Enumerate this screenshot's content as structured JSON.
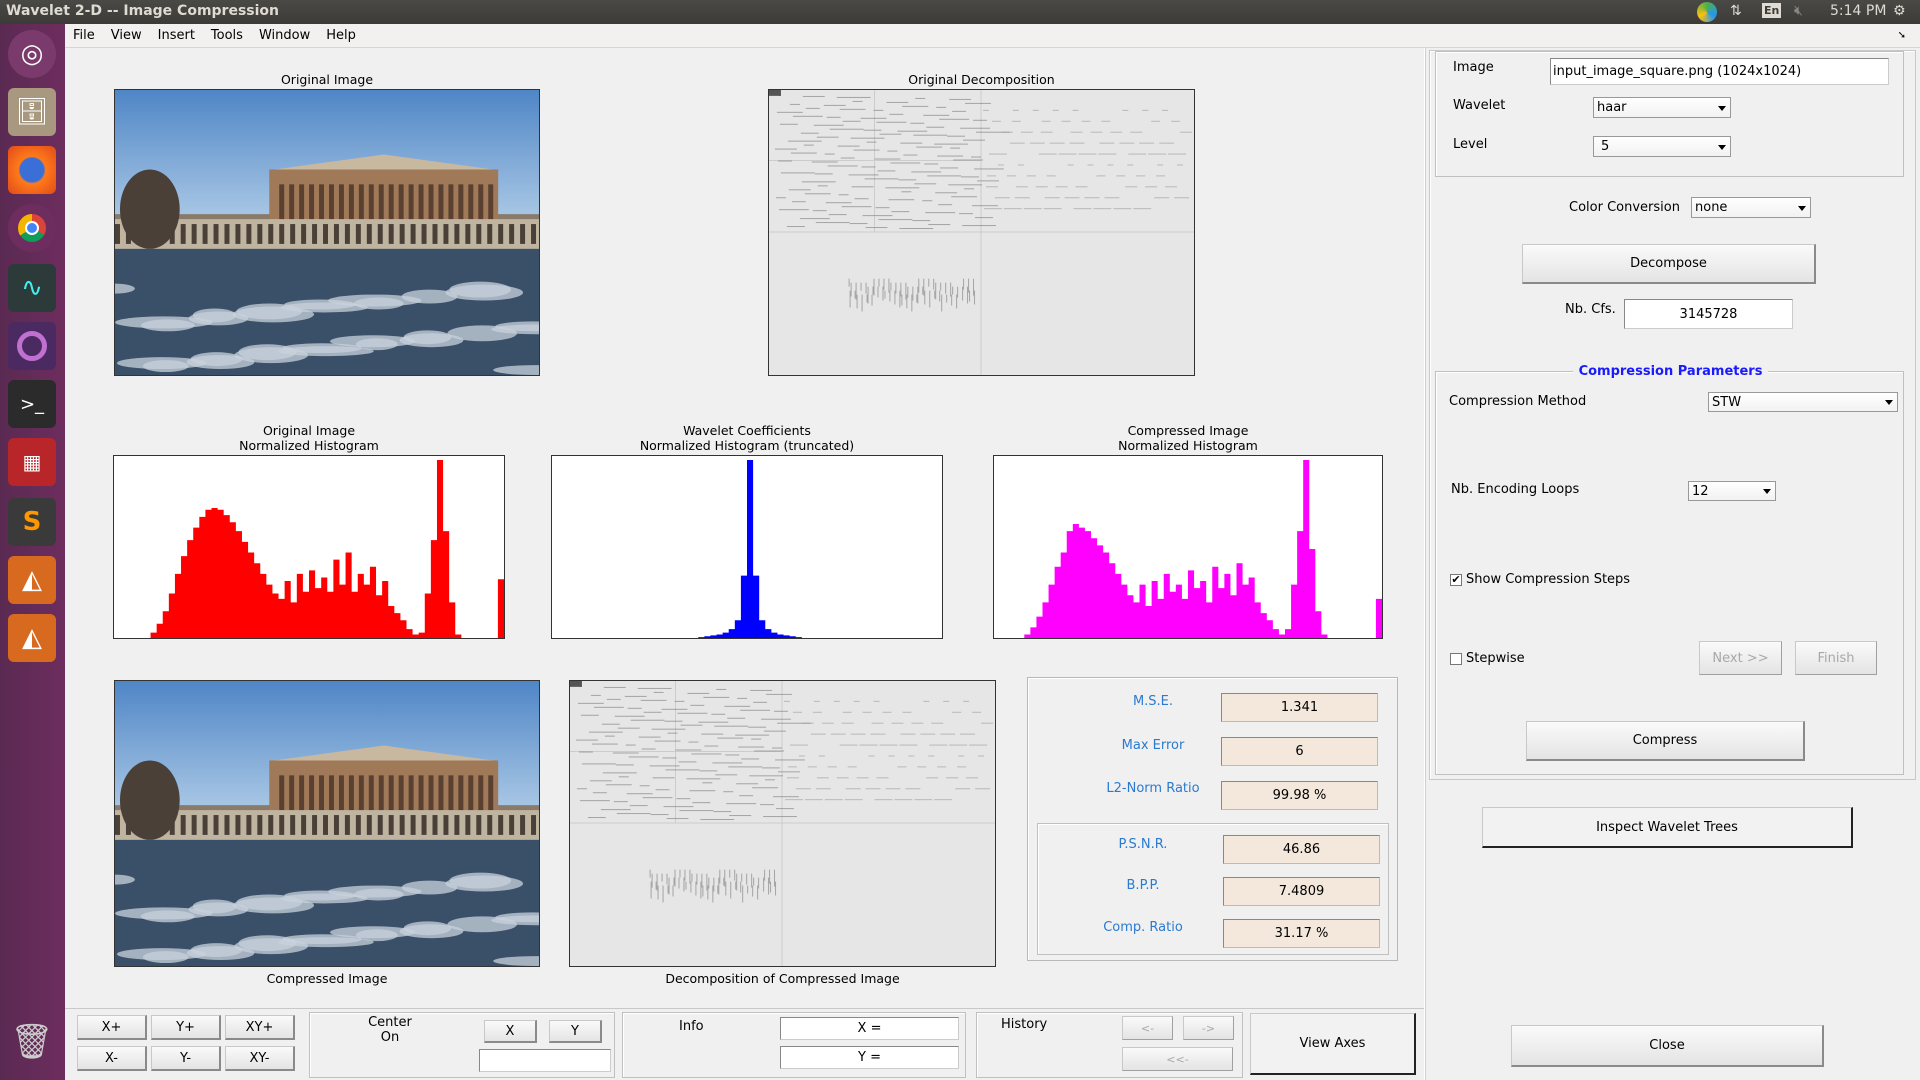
{
  "window": {
    "title": "Wavelet 2-D -- Image Compression",
    "time": "5:14 PM",
    "keyboard": "En"
  },
  "menu": [
    "File",
    "View",
    "Insert",
    "Tools",
    "Window",
    "Help"
  ],
  "launcher": [
    "ubuntu-dash-icon",
    "files-icon",
    "firefox-icon",
    "chrome-icon",
    "system-monitor-icon",
    "app-icon",
    "terminal-icon",
    "presentation-icon",
    "sublime-text-icon",
    "matlab-icon",
    "matlab-icon",
    "trash-icon"
  ],
  "axes": {
    "original_image": "Original Image",
    "original_decomposition": "Original Decomposition",
    "hist_original": [
      "Original Image",
      "Normalized Histogram"
    ],
    "hist_coeffs": [
      "Wavelet Coefficients",
      "Normalized Histogram (truncated)"
    ],
    "hist_compressed": [
      "Compressed Image",
      "Normalized Histogram"
    ],
    "compressed_image": "Compressed Image",
    "compressed_decomposition": "Decomposition of Compressed Image"
  },
  "histograms": {
    "original": {
      "color": "#ff0000",
      "values": [
        0,
        0,
        0,
        0,
        0,
        0,
        0.03,
        0.08,
        0.15,
        0.25,
        0.36,
        0.46,
        0.55,
        0.62,
        0.68,
        0.72,
        0.73,
        0.72,
        0.69,
        0.65,
        0.6,
        0.54,
        0.48,
        0.42,
        0.36,
        0.3,
        0.25,
        0.22,
        0.32,
        0.2,
        0.36,
        0.26,
        0.38,
        0.28,
        0.34,
        0.26,
        0.44,
        0.3,
        0.48,
        0.26,
        0.36,
        0.3,
        0.4,
        0.24,
        0.32,
        0.18,
        0.14,
        0.1,
        0.05,
        0.02,
        0.03,
        0.25,
        0.55,
        1.0,
        0.6,
        0.2,
        0.02,
        0,
        0,
        0,
        0,
        0,
        0,
        0.33
      ]
    },
    "coefficients": {
      "color": "#0000ff",
      "values": [
        0,
        0,
        0,
        0,
        0,
        0,
        0,
        0,
        0,
        0,
        0,
        0,
        0,
        0,
        0,
        0,
        0,
        0,
        0,
        0,
        0,
        0,
        0,
        0,
        0.005,
        0.01,
        0.015,
        0.02,
        0.03,
        0.05,
        0.1,
        0.35,
        1.0,
        0.35,
        0.1,
        0.05,
        0.03,
        0.02,
        0.015,
        0.01,
        0.005,
        0,
        0,
        0,
        0,
        0,
        0,
        0,
        0,
        0,
        0,
        0,
        0,
        0,
        0,
        0,
        0,
        0,
        0,
        0,
        0,
        0,
        0,
        0
      ]
    },
    "compressed": {
      "color": "#ff00ff",
      "values": [
        0,
        0,
        0,
        0,
        0,
        0.02,
        0.06,
        0.12,
        0.2,
        0.3,
        0.4,
        0.48,
        0.6,
        0.64,
        0.62,
        0.6,
        0.56,
        0.52,
        0.48,
        0.42,
        0.36,
        0.3,
        0.24,
        0.2,
        0.3,
        0.18,
        0.32,
        0.22,
        0.36,
        0.26,
        0.3,
        0.22,
        0.38,
        0.28,
        0.32,
        0.2,
        0.4,
        0.28,
        0.36,
        0.24,
        0.42,
        0.3,
        0.34,
        0.2,
        0.14,
        0.1,
        0.05,
        0.02,
        0.05,
        0.3,
        0.6,
        1.0,
        0.5,
        0.15,
        0.02,
        0,
        0,
        0,
        0,
        0,
        0,
        0,
        0,
        0.22
      ]
    }
  },
  "settings": {
    "image_label": "Image",
    "image_value": "input_image_square.png  (1024x1024)",
    "wavelet_label": "Wavelet",
    "wavelet_value": "haar",
    "level_label": "Level",
    "level_value": "5",
    "color_label": "Color Conversion",
    "color_value": "none",
    "decompose": "Decompose",
    "nbcfs_label": "Nb. Cfs.",
    "nbcfs_value": "3145728"
  },
  "compression": {
    "title": "Compression Parameters",
    "method_label": "Compression Method",
    "method_value": "STW",
    "loops_label": "Nb. Encoding Loops",
    "loops_value": "12",
    "show_steps_label": "Show Compression Steps",
    "show_steps_checked": true,
    "stepwise_label": "Stepwise",
    "stepwise_checked": false,
    "next": "Next >>",
    "finish": "Finish",
    "compress": "Compress"
  },
  "inspect": "Inspect Wavelet Trees",
  "close": "Close",
  "stats": {
    "mse_label": "M.S.E.",
    "mse": "1.341",
    "maxerr_label": "Max Error",
    "maxerr": "6",
    "l2_label": "L2-Norm Ratio",
    "l2": "99.98 %",
    "psnr_label": "P.S.N.R.",
    "psnr": "46.86",
    "bpp_label": "B.P.P.",
    "bpp": "7.4809",
    "ratio_label": "Comp. Ratio",
    "ratio": "31.17 %"
  },
  "toolbar": {
    "xplus": "X+",
    "yplus": "Y+",
    "xyplus": "XY+",
    "xminus": "X-",
    "yminus": "Y-",
    "xyminus": "XY-",
    "center_label": "Center\nOn",
    "center_x": "X",
    "center_y": "Y",
    "info_label": "Info",
    "info_x": "X =",
    "info_y": "Y =",
    "history_label": "History",
    "hist_back": "<-",
    "hist_fwd": "->",
    "hist_first": "<<-",
    "view_axes": "View Axes"
  }
}
